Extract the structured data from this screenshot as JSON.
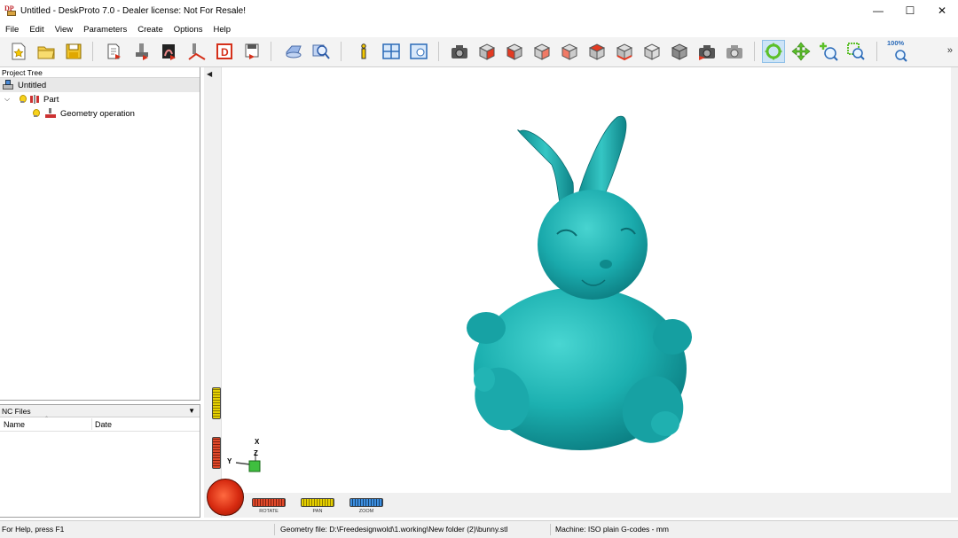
{
  "window": {
    "title": "Untitled - DeskProto 7.0 - Dealer license: Not For Resale!",
    "app_icon_text": "DP",
    "controls": {
      "minimize": "—",
      "maximize": "☐",
      "close": "✕"
    }
  },
  "menu": [
    "File",
    "Edit",
    "View",
    "Parameters",
    "Create",
    "Options",
    "Help"
  ],
  "toolbar": {
    "zoom_label": "100%",
    "overflow": "»",
    "buttons": [
      "new-project",
      "open-project",
      "save-project",
      "create-nc-files",
      "machine-setup",
      "part-parameters",
      "operation-parameters",
      "geometry-data",
      "export",
      "preview",
      "inspect",
      "info",
      "show-grid",
      "view-options",
      "camera-view",
      "front-view",
      "right-view",
      "back-view",
      "left-view",
      "top-view",
      "bottom-view",
      "iso-view-1",
      "iso-view-2",
      "camera-settings",
      "camera-reset",
      "rotate-mode",
      "pan-mode",
      "zoom-mode",
      "zoom-window",
      "zoom-all"
    ]
  },
  "project_tree": {
    "title": "Project Tree",
    "root": "Untitled",
    "part": "Part",
    "operation": "Geometry operation"
  },
  "nc_files": {
    "title": "NC Files",
    "columns": [
      "Name",
      "Date"
    ],
    "rows": []
  },
  "viewport": {
    "model": "bunny",
    "model_color": "#1fa9ab",
    "axis_labels": {
      "x": "X",
      "y": "Y",
      "z": "Z"
    },
    "controls": [
      "ROTATE",
      "PAN",
      "ZOOM"
    ]
  },
  "status": {
    "help": "For Help, press F1",
    "geometry_file": "Geometry file: D:\\Freedesignwold\\1.working\\New folder (2)\\bunny.stl",
    "machine": "Machine: ISO plain G-codes - mm"
  }
}
